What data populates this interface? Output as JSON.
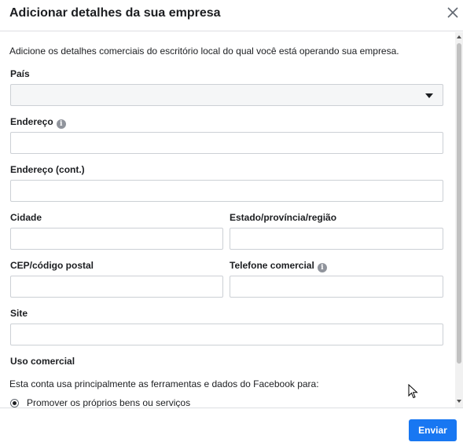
{
  "dialog": {
    "title": "Adicionar detalhes da sua empresa",
    "close_icon": "close-icon",
    "intro": "Adicione os detalhes comerciais do escritório local do qual você está operando sua empresa."
  },
  "form": {
    "country": {
      "label": "País",
      "value": ""
    },
    "address": {
      "label": "Endereço",
      "value": "",
      "info_icon": "info-icon"
    },
    "address2": {
      "label": "Endereço (cont.)",
      "value": ""
    },
    "city": {
      "label": "Cidade",
      "value": ""
    },
    "state": {
      "label": "Estado/província/região",
      "value": ""
    },
    "zip": {
      "label": "CEP/código postal",
      "value": ""
    },
    "phone": {
      "label": "Telefone comercial",
      "value": "",
      "info_icon": "info-icon"
    },
    "site": {
      "label": "Site",
      "value": ""
    },
    "usage": {
      "label": "Uso comercial",
      "description": "Esta conta usa principalmente as ferramentas e dados do Facebook para:",
      "option1": "Promover os próprios bens ou serviços"
    }
  },
  "footer": {
    "submit_label": "Enviar"
  },
  "colors": {
    "primary": "#1877f2",
    "border": "#ccd0d5",
    "select_bg": "#f5f6f7"
  }
}
